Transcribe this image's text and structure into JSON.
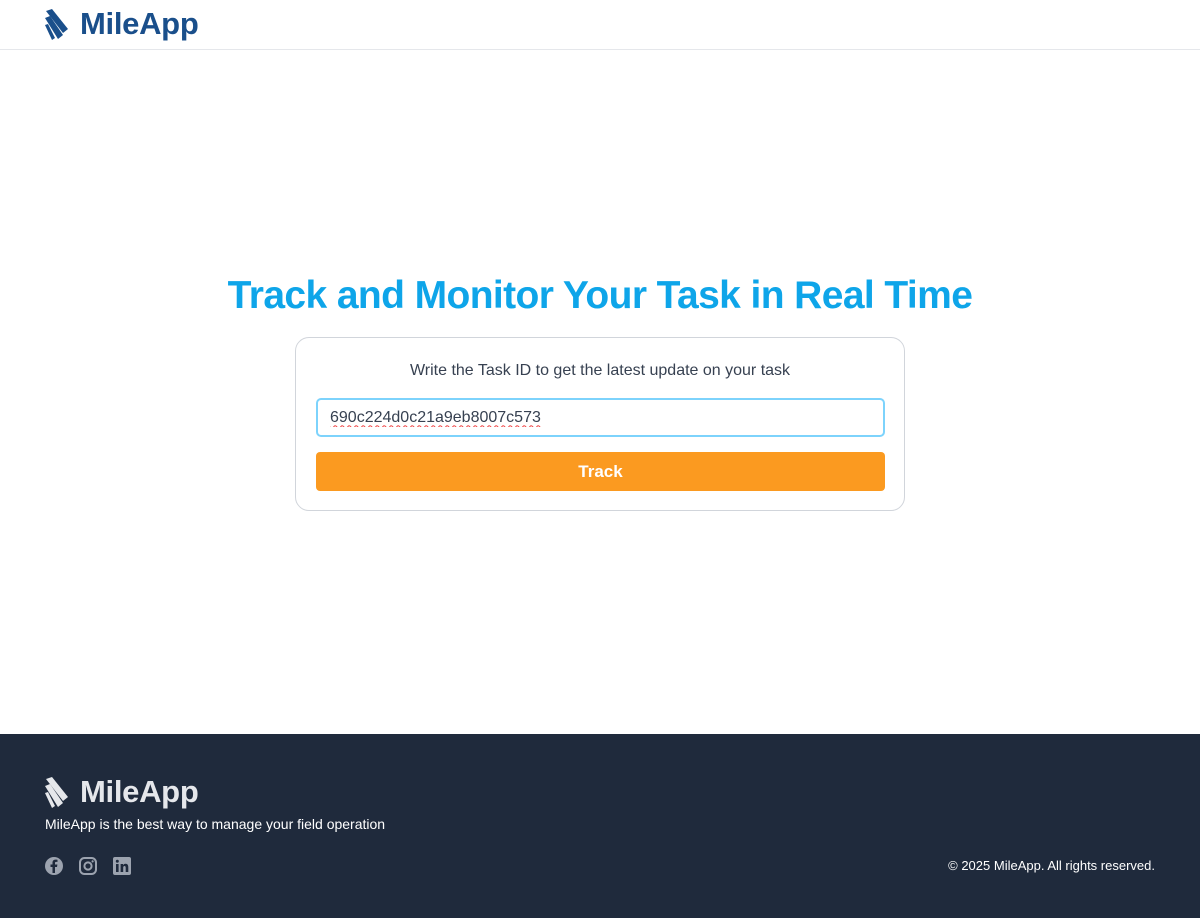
{
  "header": {
    "logo_text": "MileApp",
    "logo_icon": "mileapp-logo-icon"
  },
  "main": {
    "title": "Track and Monitor Your Task in Real Time",
    "description": "Write the Task ID to get the latest update on your task",
    "task_input_value": "690c224d0c21a9eb8007c573",
    "track_label": "Track"
  },
  "footer": {
    "logo_text": "MileApp",
    "tagline": "MileApp is the best way to manage your field operation",
    "socials": [
      "facebook-icon",
      "instagram-icon",
      "linkedin-icon"
    ],
    "copyright": "© 2025 MileApp. All rights reserved."
  },
  "colors": {
    "brand_blue": "#1a4f8b",
    "title_blue": "#0ea5e9",
    "button_orange": "#fb9a20",
    "footer_bg": "#1f2a3c"
  }
}
